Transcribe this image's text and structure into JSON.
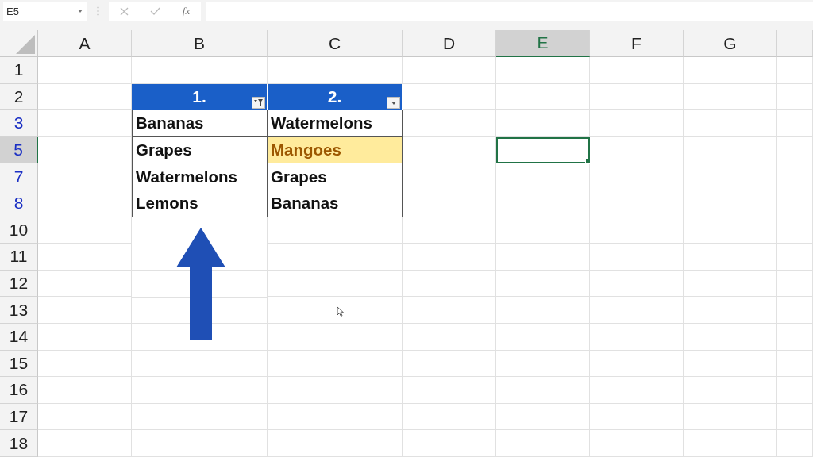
{
  "name_box": {
    "value": "E5"
  },
  "formula_bar": {
    "function_label": "fx"
  },
  "columns": [
    {
      "label": "A",
      "selected": false
    },
    {
      "label": "B",
      "selected": false
    },
    {
      "label": "C",
      "selected": false
    },
    {
      "label": "D",
      "selected": false
    },
    {
      "label": "E",
      "selected": true
    },
    {
      "label": "F",
      "selected": false
    },
    {
      "label": "G",
      "selected": false
    }
  ],
  "rows": [
    {
      "label": "1",
      "filtered": false,
      "selected": false
    },
    {
      "label": "2",
      "filtered": false,
      "selected": false
    },
    {
      "label": "3",
      "filtered": true,
      "selected": false
    },
    {
      "label": "5",
      "filtered": true,
      "selected": true
    },
    {
      "label": "7",
      "filtered": true,
      "selected": false
    },
    {
      "label": "8",
      "filtered": true,
      "selected": false
    },
    {
      "label": "10",
      "filtered": false,
      "selected": false
    },
    {
      "label": "11",
      "filtered": false,
      "selected": false
    },
    {
      "label": "12",
      "filtered": false,
      "selected": false
    },
    {
      "label": "13",
      "filtered": false,
      "selected": false
    },
    {
      "label": "14",
      "filtered": false,
      "selected": false
    },
    {
      "label": "15",
      "filtered": false,
      "selected": false
    },
    {
      "label": "16",
      "filtered": false,
      "selected": false
    },
    {
      "label": "17",
      "filtered": false,
      "selected": false
    },
    {
      "label": "18",
      "filtered": false,
      "selected": false
    }
  ],
  "table": {
    "headers": [
      {
        "label": "1.",
        "filtered": true
      },
      {
        "label": "2.",
        "filtered": false
      }
    ],
    "rows": [
      [
        {
          "text": "Bananas",
          "highlighted": false
        },
        {
          "text": "Watermelons",
          "highlighted": false
        }
      ],
      [
        {
          "text": "Grapes",
          "highlighted": false
        },
        {
          "text": "Mangoes",
          "highlighted": true
        }
      ],
      [
        {
          "text": "Watermelons",
          "highlighted": false
        },
        {
          "text": "Grapes",
          "highlighted": false
        }
      ],
      [
        {
          "text": "Lemons",
          "highlighted": false
        },
        {
          "text": "Bananas",
          "highlighted": false
        }
      ]
    ]
  }
}
